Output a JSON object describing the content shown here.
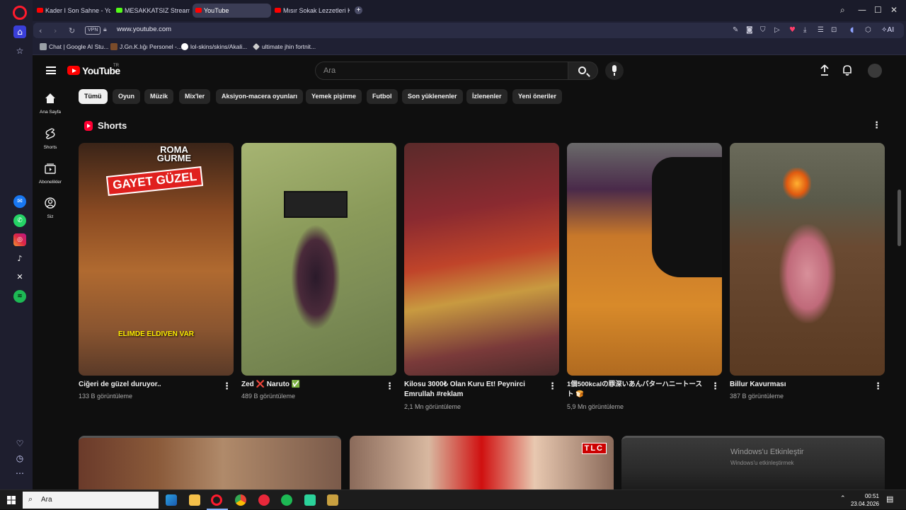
{
  "browser": {
    "tabs": [
      {
        "label": "Kader I Son Sahne - YouTu"
      },
      {
        "label": "MESAKKATSIZ Stream - W"
      },
      {
        "label": "YouTube",
        "active": true
      },
      {
        "label": "Mısır Sokak Lezzetleri Kos"
      }
    ],
    "new_tab": "+",
    "url": "www.youtube.com",
    "vpn_label": "VPN",
    "ai_label": "AI",
    "bookmarks": [
      {
        "label": "Chat | Google AI Stu..."
      },
      {
        "label": "J.Gn.K.lığı Personel -..."
      },
      {
        "label": "lol-skins/skins/Akali..."
      },
      {
        "label": "ultimate jhin fortnit..."
      }
    ]
  },
  "youtube": {
    "logo_text": "YouTube",
    "country_code": "TR",
    "search_placeholder": "Ara",
    "guide": [
      {
        "label": "Ana Sayfa"
      },
      {
        "label": "Shorts"
      },
      {
        "label": "Abonelikler"
      },
      {
        "label": "Siz"
      }
    ],
    "chips": [
      "Tümü",
      "Oyun",
      "Müzik",
      "Mix'ler",
      "Aksiyon-macera oyunları",
      "Yemek pişirme",
      "Futbol",
      "Son yüklenenler",
      "İzlenenler",
      "Yeni öneriler"
    ],
    "shorts_heading": "Shorts",
    "shorts": [
      {
        "title": "Ciğeri de güzel duruyor..",
        "views": "133 B görüntüleme",
        "overlay_top": "GAYET GÜZEL",
        "overlay_top_small": "ROMA GURME",
        "overlay_bottom": "ELIMDE ELDIVEN VAR"
      },
      {
        "title": "Zed ❌ Naruto ✅",
        "views": "489 B görüntüleme"
      },
      {
        "title": "Kilosu 3000₺ Olan Kuru Et! Peynirci Emrullah #reklam",
        "views": "2,1 Mn görüntüleme"
      },
      {
        "title": "1個500kcalの罪深いあんバターハニートースト 🍞",
        "views": "5,9 Mn görüntüleme"
      },
      {
        "title": "Billur Kavurması",
        "views": "387 B görüntüleme"
      }
    ],
    "videos": [
      {
        "overlay": ""
      },
      {
        "overlay": "TLC"
      },
      {
        "overlay": "Windows'u Etkinleştir",
        "overlay2": "Windows'u etkinleştirmek"
      }
    ]
  },
  "taskbar": {
    "search_placeholder": "Ara",
    "time": "00:51",
    "date": "23.04.2026"
  },
  "colors": {
    "youtube_red": "#ff0000",
    "opera_red": "#ff1b2d",
    "background": "#0f0f0f",
    "chip": "#272727"
  }
}
